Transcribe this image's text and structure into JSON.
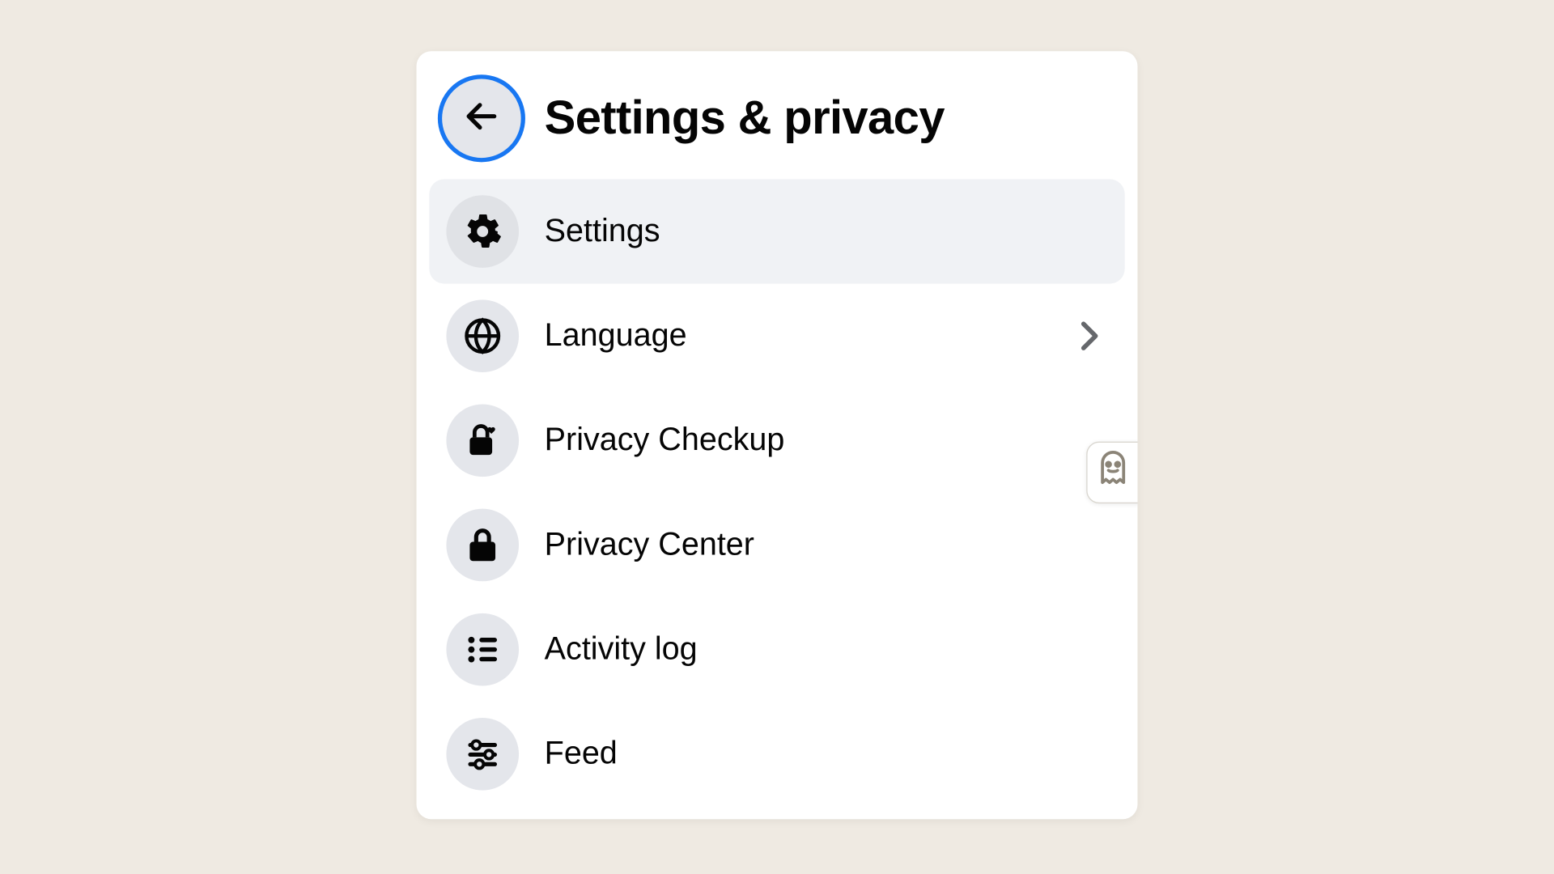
{
  "header": {
    "title": "Settings & privacy"
  },
  "menu": {
    "items": [
      {
        "label": "Settings",
        "icon": "gear-icon",
        "selected": true,
        "chevron": false
      },
      {
        "label": "Language",
        "icon": "globe-icon",
        "selected": false,
        "chevron": true
      },
      {
        "label": "Privacy Checkup",
        "icon": "lock-heart-icon",
        "selected": false,
        "chevron": false
      },
      {
        "label": "Privacy Center",
        "icon": "lock-icon",
        "selected": false,
        "chevron": false
      },
      {
        "label": "Activity log",
        "icon": "list-icon",
        "selected": false,
        "chevron": false
      },
      {
        "label": "Feed",
        "icon": "feed-sliders-icon",
        "selected": false,
        "chevron": false
      }
    ]
  }
}
